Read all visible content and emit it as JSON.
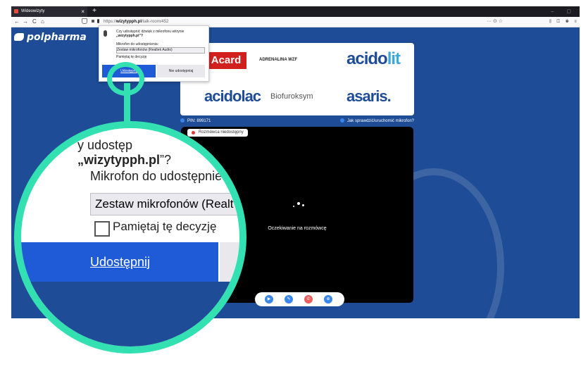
{
  "browser": {
    "tab_title": "Wideowizyty",
    "tab_close": "×",
    "new_tab": "+",
    "window_controls": "– ▢",
    "nav": {
      "back": "←",
      "forward": "→",
      "reload": "C",
      "home": "⌂"
    },
    "url_prefix": "https://",
    "url_host": "wizytypph.pl",
    "url_path": "/talk-room/452",
    "url_actions": "··· ⊙ ☆",
    "toolbar_right": "⫼ ◫ ◉ ≡"
  },
  "page": {
    "brand": "polpharma",
    "sponsors": {
      "acard": "Acard",
      "adrenalina": "ADRENALINA WZF",
      "acidolit_a": "acido",
      "acidolit_b": "lit",
      "acidolac": "acidolac",
      "biofuroksym": "Biofuroksym",
      "asaris": "asaris."
    },
    "pin": "PIN: 899171",
    "howto": "Jak sprawdzić/uruchomić mikrofon?",
    "status": "Rozmówca niedostępny",
    "waiting": "Oczekiwanie na rozmówcę",
    "call_buttons": [
      "▶",
      "✎",
      "✆",
      "⊕"
    ]
  },
  "popup": {
    "question_a": "Czy udostępnić dźwięk z mikrofonu witrynie",
    "question_b": "„wizytypph.pl”?",
    "mic_label": "Mikrofon do udostępnienia:",
    "mic_value": "Zestaw mikrofonów (Realtek Audio)",
    "remember": "Pamiętaj tę decyzję",
    "allow": "Udostępnij",
    "deny": "Nie udostępniaj"
  },
  "zoom": {
    "q_prefix": "y udostęp",
    "q_host": "„wizytypph.pl",
    "q_suffix": "”?",
    "mic_label": "Mikrofon do udostępnie",
    "mic_value": "Zestaw mikrofonów (Realt",
    "remember": "Pamiętaj tę decyzję",
    "allow": "Udostępnij"
  },
  "colors": {
    "page_bg": "#1e4c96",
    "accent_zoom": "#33e0b2",
    "allow_button": "#1f5bd6",
    "hangup": "#e85d5d"
  }
}
